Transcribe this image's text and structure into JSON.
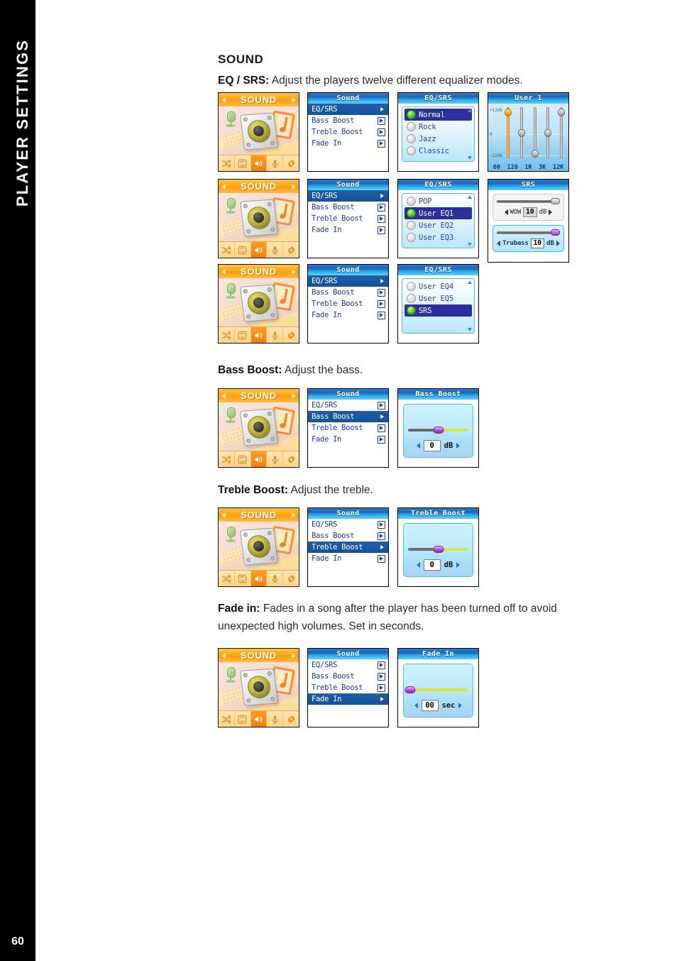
{
  "sidebar": {
    "chapter_title": "PLAYER SETTINGS",
    "page_number": "60"
  },
  "section": {
    "title": "SOUND"
  },
  "descriptions": {
    "eq_srs_label": "EQ / SRS:",
    "eq_srs_text": " Adjust the players twelve different equalizer modes.",
    "bass_label": "Bass Boost:",
    "bass_text": " Adjust the bass.",
    "treble_label": "Treble Boost:",
    "treble_text": " Adjust the treble.",
    "fade_label": "Fade in:",
    "fade_text": " Fades in a song after the player has been turned off to avoid unexpected high volumes. Set in seconds."
  },
  "sound_home": {
    "title": "SOUND",
    "toolbar_icons": [
      "shuffle-icon",
      "repeat-icon",
      "speaker-icon",
      "microphone-icon",
      "gear-icon"
    ],
    "active_icon_index": 2
  },
  "sound_menu": {
    "title": "Sound",
    "items": [
      {
        "label": "EQ/SRS"
      },
      {
        "label": "Bass Boost"
      },
      {
        "label": "Treble Boost"
      },
      {
        "label": "Fade In"
      }
    ]
  },
  "eq_list_1": {
    "title": "EQ/SRS",
    "items": [
      {
        "label": "Normal",
        "selected": true
      },
      {
        "label": "Rock",
        "selected": false
      },
      {
        "label": "Jazz",
        "selected": false
      },
      {
        "label": "Classic",
        "selected": false
      }
    ]
  },
  "eq_list_2": {
    "title": "EQ/SRS",
    "items": [
      {
        "label": "POP",
        "selected": false
      },
      {
        "label": "User EQ1",
        "selected": true
      },
      {
        "label": "User EQ2",
        "selected": false
      },
      {
        "label": "User EQ3",
        "selected": false
      }
    ]
  },
  "eq_list_3": {
    "title": "EQ/SRS",
    "items": [
      {
        "label": "User EQ4",
        "selected": false
      },
      {
        "label": "User EQ5",
        "selected": false
      },
      {
        "label": "SRS",
        "selected": true
      }
    ]
  },
  "user_eq": {
    "title": "User 1",
    "y_labels": {
      "top": "+12db",
      "mid": "0",
      "bottom": "-12db"
    },
    "bands": [
      {
        "label": "60",
        "position": "top",
        "highlight": true
      },
      {
        "label": "120",
        "position": "middle",
        "highlight": false
      },
      {
        "label": "1K",
        "position": "bottom",
        "highlight": false
      },
      {
        "label": "3K",
        "position": "middle",
        "highlight": false
      },
      {
        "label": "12K",
        "position": "top",
        "highlight": false
      }
    ]
  },
  "srs": {
    "title": "SRS",
    "controls": [
      {
        "name": "WOW",
        "value": "10",
        "unit": "dB",
        "active": false
      },
      {
        "name": "Trubass",
        "value": "10",
        "unit": "dB",
        "active": true
      }
    ]
  },
  "bass_boost_screen": {
    "title": "Bass Boost",
    "value": "0",
    "unit": "dB",
    "slider_percent": 50
  },
  "treble_boost_screen": {
    "title": "Treble Boost",
    "value": "0",
    "unit": "dB",
    "slider_percent": 50
  },
  "fade_in_screen": {
    "title": "Fade In",
    "value": "00",
    "unit": "sec",
    "slider_percent": 3
  },
  "colors": {
    "sidebar_bg": "#000000",
    "lcd_title_blue": "#1e63b6",
    "lcd_cyan": "#5fd0f7",
    "orange_title": "#ffa517",
    "selection_navy": "#2b2f9e",
    "menu_text_blue": "#1b39a8",
    "eq_knob_gold": "#f4b81d",
    "slider_purple": "#b44ad6",
    "slider_green": "#d8e63a"
  }
}
